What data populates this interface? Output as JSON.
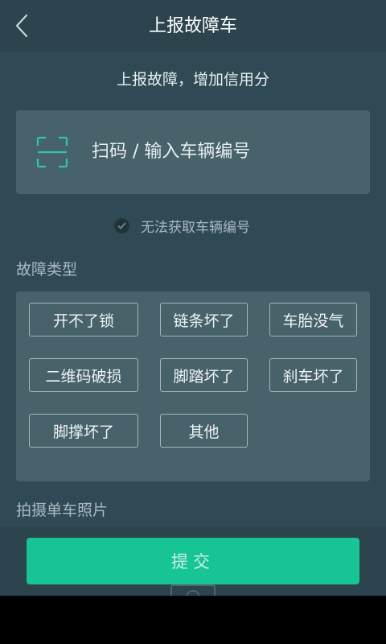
{
  "header": {
    "title": "上报故障车",
    "back_icon": "chevron-left"
  },
  "subtitle": "上报故障，增加信用分",
  "scan": {
    "icon": "scan-frame",
    "label": "扫码 / 输入车辆编号"
  },
  "no_code": {
    "icon": "check-circle",
    "label": "无法获取车辆编号"
  },
  "fault_section": {
    "title": "故障类型",
    "options": [
      "开不了锁",
      "链条坏了",
      "车胎没气",
      "二维码破损",
      "脚踏坏了",
      "刹车坏了",
      "脚撑坏了",
      "其他"
    ]
  },
  "photo_section": {
    "title": "拍摄单车照片",
    "icon": "camera"
  },
  "submit": {
    "label": "提交"
  },
  "colors": {
    "background": "#2f4a55",
    "header": "#2b444e",
    "panel": "#47626b",
    "accent": "#17c494",
    "scan_icon": "#2fc7a6"
  }
}
